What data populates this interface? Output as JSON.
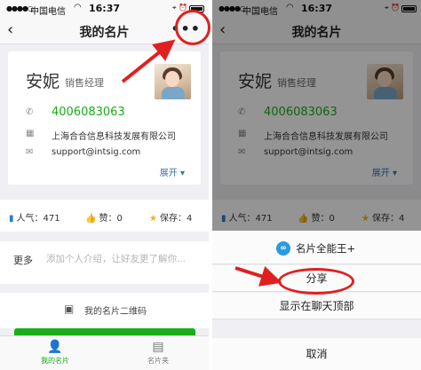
{
  "status": {
    "carrier": "中国电信",
    "time": "16:37"
  },
  "nav": {
    "title": "我的名片",
    "back_icon": "chevron-left-icon",
    "more_icon": "more-dots-icon"
  },
  "card": {
    "name": "安妮",
    "job": "销售经理",
    "phone": "4006083063",
    "company": "上海合合信息科技发展有限公司",
    "email": "support@intsig.com",
    "expand": "展开 ▾"
  },
  "stats": {
    "popularity": "人气：471",
    "likes": "赞：0",
    "saves": "保存：4"
  },
  "intro": {
    "label": "更多",
    "placeholder": "添加个人介绍，让好友更了解你..."
  },
  "qr": {
    "label": "我的名片二维码"
  },
  "tabs": [
    {
      "label": "我的名片",
      "active": true
    },
    {
      "label": "名片夹",
      "active": false
    }
  ],
  "sheet": {
    "app_name": "名片全能王+",
    "options": [
      "分享",
      "显示在聊天顶部"
    ],
    "cancel": "取消"
  },
  "colors": {
    "accent_green": "#1aad19",
    "link_blue": "#3d6eb1",
    "annotation_red": "#e02020"
  }
}
